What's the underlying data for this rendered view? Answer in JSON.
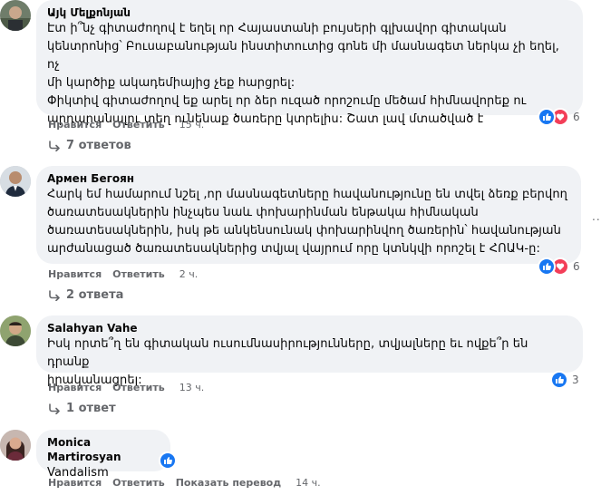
{
  "comments": [
    {
      "author": "Այկ Մելքոնյան",
      "text": "Էտ ի՞նչ գիտաժողով է եղել որ Հայաստանի բույսերի գլխավոր գիտական\nկենտրոնից՝ Բուսաբանության ինստիտուտից գոնե մի մասնագետ ներկա չի եղել, ոչ\nմի կարծիք ակադեմիայից չեք հարցրել:\nՓիկտիվ գիտաժողով եք արել որ ձեր ուզած որոշումը մեծամ հիմնավորեք ու\nարդարանալու տեղ ունենաք ծառերը կտրելիս: Շատ լավ մտածված է",
      "like": "Нравится",
      "reply": "Ответить",
      "time": "15 ч.",
      "reaction_count": "6",
      "replies_label": "7 ответов"
    },
    {
      "author": "Армен Бегоян",
      "text": "Հարկ եմ համարում նշել ,որ մասնագետները հավանությունը են տվել ձեռք բերվող\nծառատեսակներին ինչպես նաև փոխարինման ենթակա հիմնական\nծառատեսակներին, իսկ թե անկենսունակ փոխարինվող ծառերին՝ հավանության\nարժանացած ծառատեսակներից տվյալ վայրում որը կտնկվի որոշել է ՀՈԱԿ-ը:",
      "like": "Нравится",
      "reply": "Ответить",
      "time": "2 ч.",
      "reaction_count": "6",
      "replies_label": "2 ответа"
    },
    {
      "author": "Salahyan Vahe",
      "text": "Իսկ որտե՞ղ են գիտական ուսումնասիրությունները, տվյալները եւ ովքե՞ր են դրանք\nիրականացրել:",
      "like": "Нравится",
      "reply": "Ответить",
      "time": "13 ч.",
      "reaction_count": "3",
      "replies_label": "1 ответ"
    },
    {
      "author": "Monica Martirosyan",
      "text": "Vandalism",
      "like": "Нравится",
      "reply": "Ответить",
      "translate": "Показать перевод",
      "time": "14 ч."
    }
  ],
  "more_options": "..."
}
